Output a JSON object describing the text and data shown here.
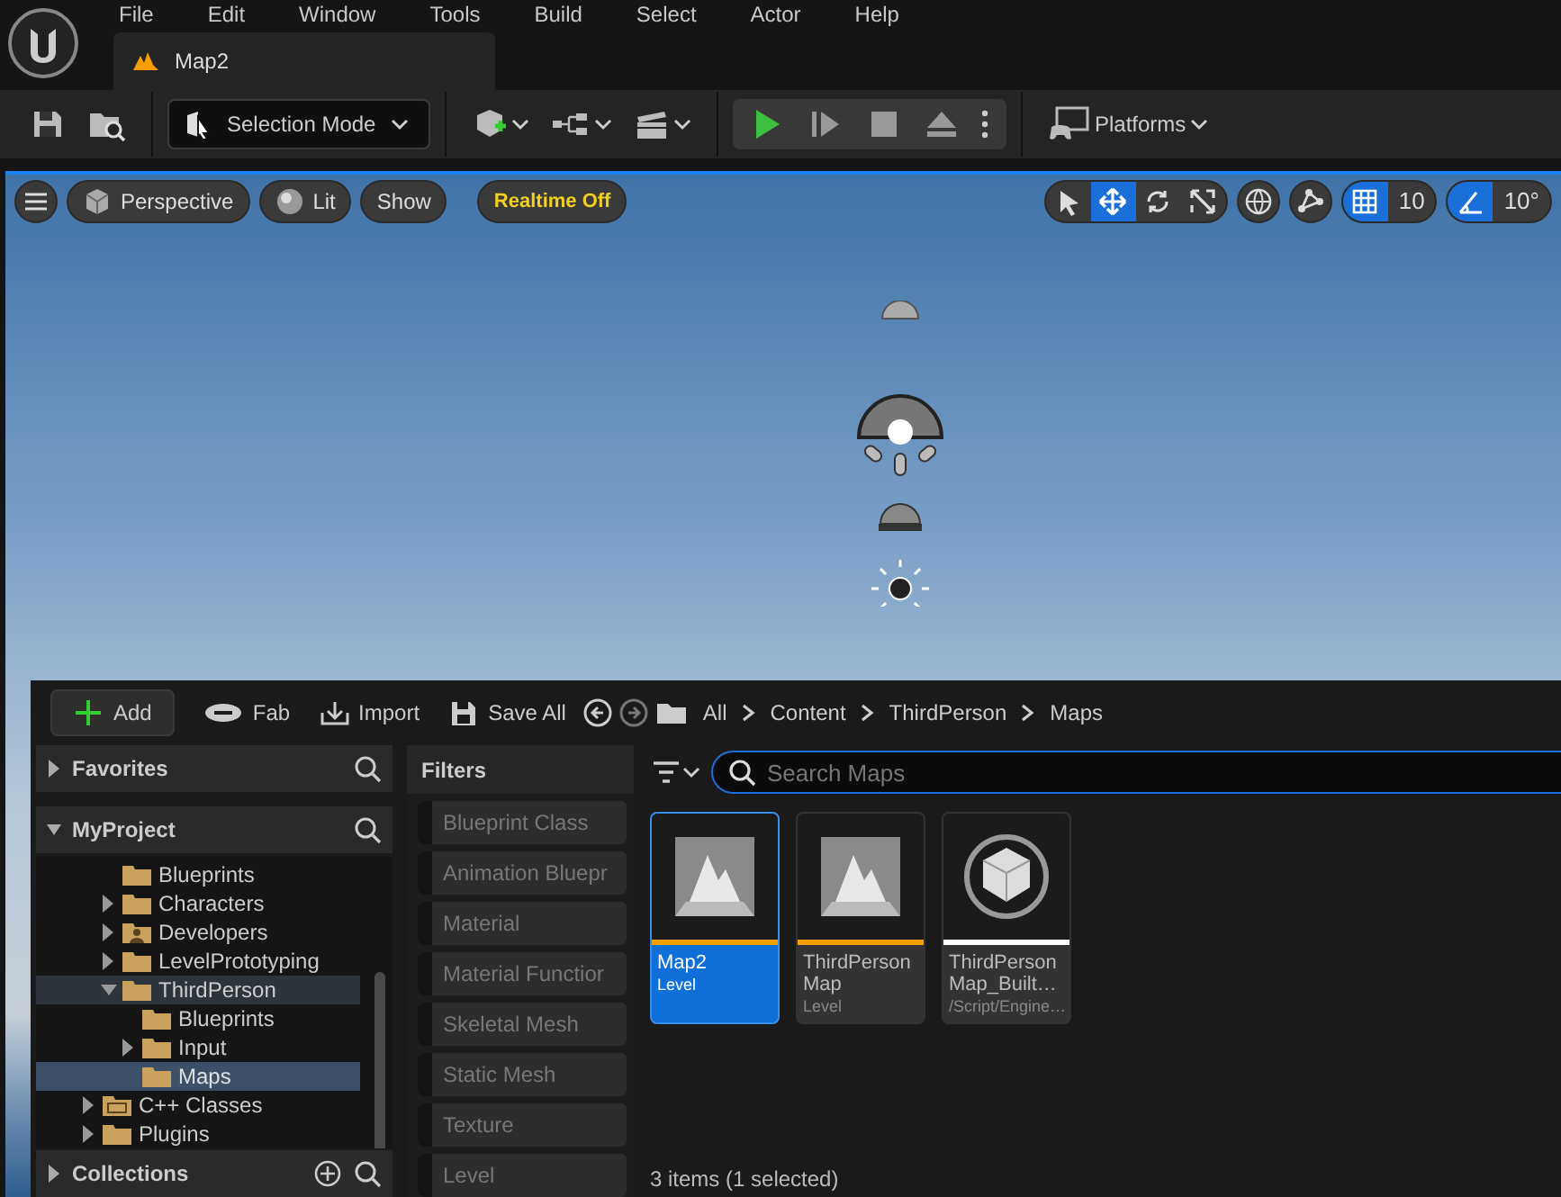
{
  "menu": [
    "File",
    "Edit",
    "Window",
    "Tools",
    "Build",
    "Select",
    "Actor",
    "Help"
  ],
  "tabs": [
    {
      "title": "Map2",
      "selected": true
    }
  ],
  "toolbar": {
    "selection_mode": "Selection Mode",
    "platforms": "Platforms"
  },
  "viewport_toolbar": {
    "perspective": "Perspective",
    "lit": "Lit",
    "show": "Show",
    "realtime": "Realtime Off",
    "transform_tools": [
      {
        "kind": "select",
        "selected": false
      },
      {
        "kind": "translate",
        "selected": true
      },
      {
        "kind": "rotate",
        "selected": false
      },
      {
        "kind": "scale",
        "selected": false
      }
    ],
    "grid_snap": {
      "on": true,
      "value": "10"
    },
    "rotation_snap": {
      "on": true,
      "value": "10°"
    }
  },
  "content_browser": {
    "actions": [
      {
        "kind": "add",
        "label": "Add"
      },
      {
        "kind": "fab",
        "label": "Fab"
      },
      {
        "kind": "import",
        "label": "Import"
      },
      {
        "kind": "save",
        "label": "Save All"
      }
    ],
    "breadcrumbs": [
      "All",
      "Content",
      "ThirdPerson",
      "Maps"
    ],
    "favorites": {
      "title": "Favorites",
      "expanded": false
    },
    "project": {
      "title": "MyProject",
      "expanded": true
    },
    "content_folder_children": [
      {
        "name": "Blueprints",
        "kind": "folder",
        "selected": false
      },
      {
        "name": "Characters",
        "kind": "folder",
        "expanded": false,
        "selected": false
      },
      {
        "name": "Developers",
        "kind": "developers",
        "expanded": false,
        "selected": false
      },
      {
        "name": "LevelPrototyping",
        "kind": "folder",
        "expanded": false,
        "selected": false
      },
      {
        "name": "ThirdPerson",
        "kind": "folder",
        "expanded": true,
        "selected": false,
        "children": [
          {
            "name": "Blueprints",
            "kind": "folder",
            "selected": false
          },
          {
            "name": "Input",
            "kind": "folder",
            "expanded": false,
            "selected": false
          },
          {
            "name": "Maps",
            "kind": "folder",
            "selected": true
          }
        ]
      }
    ],
    "tree_roots": [
      {
        "name": "C++ Classes",
        "kind": "cpp",
        "expanded": false,
        "selected": false
      },
      {
        "name": "Plugins",
        "kind": "folder",
        "expanded": false,
        "selected": false
      }
    ],
    "collections": {
      "title": "Collections",
      "expanded": false
    },
    "filters_title": "Filters",
    "filters": [
      {
        "label": "Blueprint Class",
        "checked": false
      },
      {
        "label": "Animation Bluepr",
        "checked": false
      },
      {
        "label": "Material",
        "checked": false
      },
      {
        "label": "Material Functior",
        "checked": false
      },
      {
        "label": "Skeletal Mesh",
        "checked": false
      },
      {
        "label": "Static Mesh",
        "checked": false
      },
      {
        "label": "Texture",
        "checked": false
      },
      {
        "label": "Level",
        "checked": false
      }
    ],
    "search": {
      "placeholder": "Search Maps"
    },
    "assets": [
      {
        "name": "Map2",
        "type": "Level",
        "kind": "level",
        "color": "#f5a000",
        "selected": true
      },
      {
        "name": "ThirdPerson Map",
        "type": "Level",
        "kind": "level",
        "color": "#f5a000",
        "selected": false
      },
      {
        "name": "ThirdPerson Map_Built…",
        "type": "/Script/Engine…",
        "kind": "data",
        "color": "#ffffff",
        "selected": false
      }
    ],
    "status": "3 items (1 selected)"
  }
}
